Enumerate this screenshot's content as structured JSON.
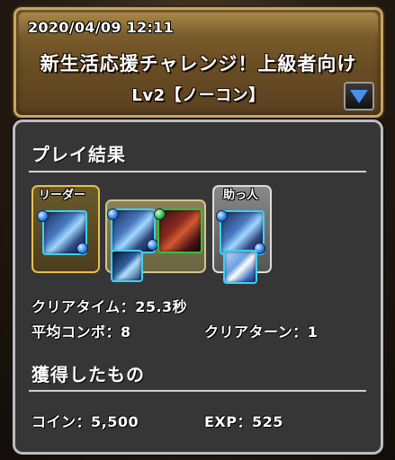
{
  "header": {
    "datetime": "2020/04/09 12:11",
    "dungeon_name": "新生活応援チャレンジ！上級者向け",
    "difficulty": "Lv2【ノーコン】",
    "dropdown_icon": "triangle-down-icon"
  },
  "result": {
    "section_title": "プレイ結果",
    "leader_label": "リーダー",
    "helper_label": "助っ人",
    "team": {
      "leader": "leader-monster-icon",
      "subs": [
        "sub-monster-1-icon",
        "sub-monster-2-icon"
      ],
      "helper": "helper-monster-icon"
    },
    "clear_time_label": "クリアタイム：",
    "clear_time_value": "25.3秒",
    "avg_combo_label": "平均コンボ：",
    "avg_combo_value": "8",
    "clear_turn_label": "クリアターン：",
    "clear_turn_value": "1"
  },
  "rewards": {
    "section_title": "獲得したもの",
    "coin_label": "コイン：",
    "coin_value": "5,500",
    "exp_label": "EXP：",
    "exp_value": "525"
  },
  "colors": {
    "banner_border": "#c9a460",
    "panel_bg": "#363636",
    "leader_frame": "#e6c050",
    "dropdown_arrow": "#4a8ef0"
  }
}
